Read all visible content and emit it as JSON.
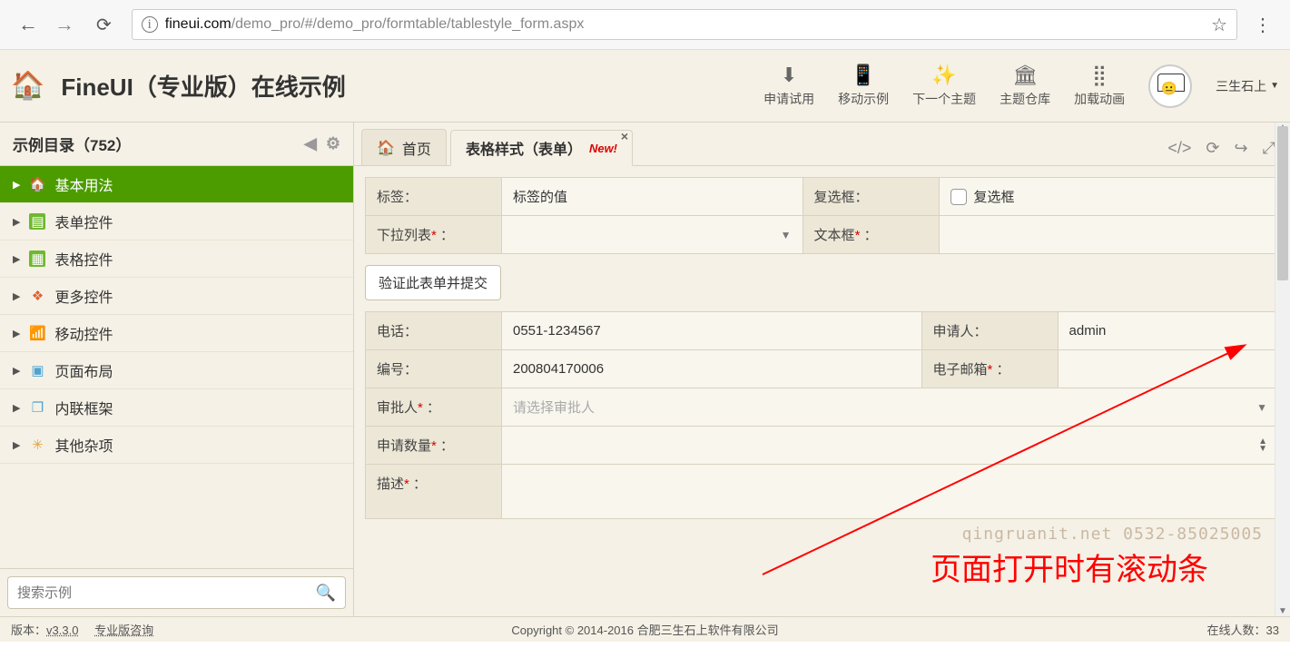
{
  "browser": {
    "host": "fineui.com",
    "path": "/demo_pro/#/demo_pro/formtable/tablestyle_form.aspx"
  },
  "header": {
    "title": "FineUI（专业版）在线示例",
    "tools": [
      {
        "icon": "⬇",
        "label": "申请试用"
      },
      {
        "icon": "📱",
        "label": "移动示例"
      },
      {
        "icon": "✨",
        "label": "下一个主题"
      },
      {
        "icon": "🏛",
        "label": "主题仓库"
      },
      {
        "icon": "⣿",
        "label": "加载动画"
      }
    ],
    "user": "三生石上"
  },
  "sidebar": {
    "title": "示例目录（752）",
    "items": [
      {
        "label": "基本用法",
        "active": true,
        "iconClass": "ic-house-sm",
        "icon": "🏠"
      },
      {
        "label": "表单控件",
        "iconClass": "ic-form",
        "icon": "▤"
      },
      {
        "label": "表格控件",
        "iconClass": "ic-table",
        "icon": "▦"
      },
      {
        "label": "更多控件",
        "iconClass": "ic-more",
        "icon": "❖"
      },
      {
        "label": "移动控件",
        "iconClass": "ic-mobile",
        "icon": "📶"
      },
      {
        "label": "页面布局",
        "iconClass": "ic-layout",
        "icon": "▣"
      },
      {
        "label": "内联框架",
        "iconClass": "ic-iframe",
        "icon": "❐"
      },
      {
        "label": "其他杂项",
        "iconClass": "ic-misc",
        "icon": "✳"
      }
    ],
    "search_placeholder": "搜索示例"
  },
  "tabs": {
    "home": "首页",
    "current": "表格样式（表单）",
    "badge": "New!"
  },
  "form1": {
    "label_lbl": "标签：",
    "label_val": "标签的值",
    "checkbox_lbl": "复选框：",
    "checkbox_text": "复选框",
    "dropdown_lbl": "下拉列表",
    "textbox_lbl": "文本框"
  },
  "submit_btn": "验证此表单并提交",
  "form2": {
    "phone_lbl": "电话：",
    "phone_val": "0551-1234567",
    "applicant_lbl": "申请人：",
    "applicant_val": "admin",
    "id_lbl": "编号：",
    "id_val": "200804170006",
    "email_lbl": "电子邮箱",
    "approver_lbl": "审批人",
    "approver_placeholder": "请选择审批人",
    "qty_lbl": "申请数量",
    "desc_lbl": "描述"
  },
  "annotation": "页面打开时有滚动条",
  "watermark": "qingruanit.net 0532-85025005",
  "footer": {
    "version_label": "版本：",
    "version": "v3.3.0",
    "consult": "专业版咨询",
    "copyright": "Copyright © 2014-2016 合肥三生石上软件有限公司",
    "online_label": "在线人数：",
    "online_count": "33"
  },
  "colon": "："
}
